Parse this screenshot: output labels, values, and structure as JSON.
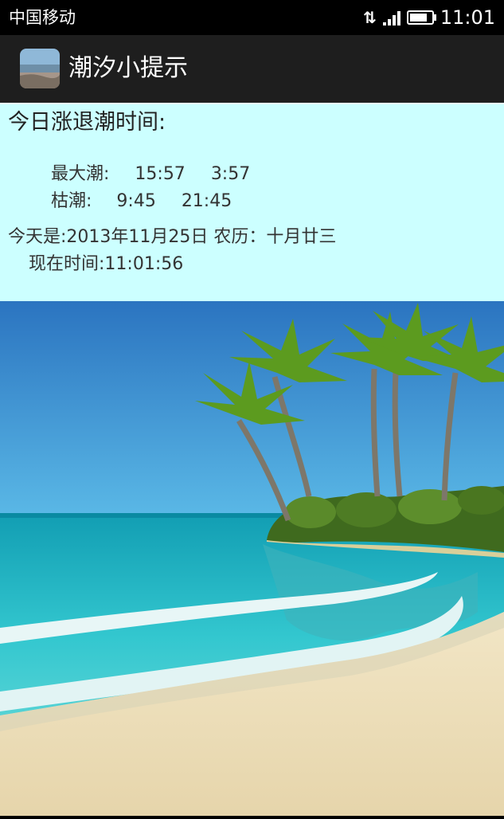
{
  "status_bar": {
    "carrier": "中国移动",
    "time": "11:01",
    "data_icon": "(⇅)",
    "battery_level": 0.7
  },
  "action_bar": {
    "title": "潮汐小提示",
    "icon": "beach-thumbnail"
  },
  "tide_info": {
    "heading": "今日涨退潮时间:",
    "high_tide": {
      "label": "最大潮:",
      "times": [
        "15:57",
        "3:57"
      ]
    },
    "low_tide": {
      "label": "枯潮:",
      "times": [
        "9:45",
        "21:45"
      ]
    },
    "today_line": "今天是:2013年11月25日 农历：十月廿三",
    "now_line": "现在时间:11:01:56"
  },
  "colors": {
    "panel_bg": "#ccffff",
    "action_bar_bg": "#1e1e1e",
    "sky_top": "#2a78c2",
    "sea": "#2ec6cf",
    "sand": "#ecdcb4"
  }
}
